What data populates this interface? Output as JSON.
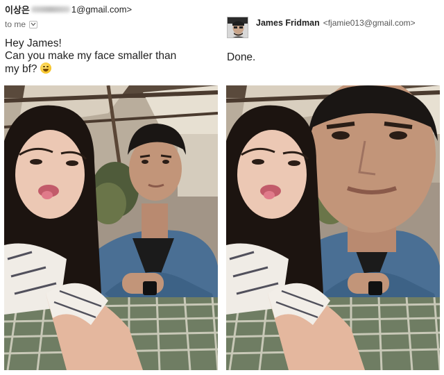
{
  "left_email": {
    "sender_name": "이상은",
    "sender_email_tail": "1@gmail.com>",
    "recipient_label": "to me",
    "message_lines": [
      "Hey James!",
      "Can you make my face smaller than",
      "my bf?"
    ],
    "emoji_icon": "grinning-sweat-emoji"
  },
  "right_email": {
    "sender_name": "James Fridman",
    "sender_email": "<fjamie013@gmail.com>",
    "message": "Done."
  },
  "photos": {
    "original": "original-couple-selfie",
    "edited": "edited-couple-selfie-big-face"
  },
  "colors": {
    "shirt_denim": "#4a6f94",
    "tablecloth": "#6f7d63"
  }
}
